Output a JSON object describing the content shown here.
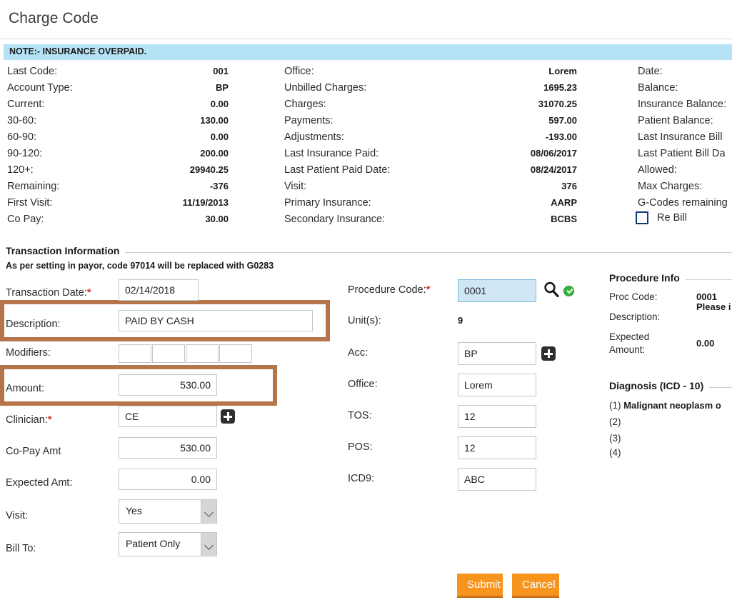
{
  "header": {
    "title": "Charge Code"
  },
  "note": {
    "text": "NOTE:- INSURANCE OVERPAID."
  },
  "summary": {
    "column1": [
      {
        "label": "Last Code:",
        "value": "001"
      },
      {
        "label": "Account Type:",
        "value": "BP"
      },
      {
        "label": "Current:",
        "value": "0.00"
      },
      {
        "label": "30-60:",
        "value": "130.00"
      },
      {
        "label": "60-90:",
        "value": "0.00"
      },
      {
        "label": "90-120:",
        "value": "200.00"
      },
      {
        "label": "120+:",
        "value": "29940.25"
      },
      {
        "label": "Remaining:",
        "value": "-376"
      },
      {
        "label": "First Visit:",
        "value": "11/19/2013"
      },
      {
        "label": "Co Pay:",
        "value": "30.00"
      }
    ],
    "column2": [
      {
        "label": "Office:",
        "value": "Lorem"
      },
      {
        "label": "Unbilled Charges:",
        "value": "1695.23"
      },
      {
        "label": "Charges:",
        "value": "31070.25"
      },
      {
        "label": "Payments:",
        "value": "597.00"
      },
      {
        "label": "Adjustments:",
        "value": "-193.00"
      },
      {
        "label": "Last Insurance Paid:",
        "value": "08/06/2017"
      },
      {
        "label": "Last Patient Paid Date:",
        "value": "08/24/2017"
      },
      {
        "label": "Visit:",
        "value": "376"
      },
      {
        "label": "Primary Insurance:",
        "value": "AARP"
      },
      {
        "label": "Secondary Insurance:",
        "value": "BCBS"
      }
    ],
    "column3": [
      {
        "label": "Date:"
      },
      {
        "label": "Balance:"
      },
      {
        "label": "Insurance Balance:"
      },
      {
        "label": "Patient Balance:"
      },
      {
        "label": "Last Insurance Bill"
      },
      {
        "label": "Last Patient Bill Da"
      },
      {
        "label": "Allowed:"
      },
      {
        "label": "Max Charges:"
      },
      {
        "label": "G-Codes remaining"
      }
    ],
    "rebill": {
      "label": "Re Bill",
      "checked": false
    }
  },
  "transaction": {
    "section_title": "Transaction Information",
    "note": "As per setting in payor, code 97014 will be replaced with G0283",
    "left_fields": {
      "transaction_date": {
        "label": "Transaction Date:",
        "required": "*",
        "value": "02/14/2018"
      },
      "description": {
        "label": "Description:",
        "value": "PAID BY CASH"
      },
      "modifiers": {
        "label": "Modifiers:",
        "values": [
          "",
          "",
          "",
          ""
        ]
      },
      "amount": {
        "label": "Amount:",
        "value": "530.00"
      },
      "clinician": {
        "label": "Clinician:",
        "required": "*",
        "value": "CE"
      },
      "copay_amt": {
        "label": "Co-Pay Amt",
        "value": "530.00"
      },
      "expected_amt": {
        "label": "Expected Amt:",
        "value": "0.00"
      },
      "visit": {
        "label": "Visit:",
        "value": "Yes"
      },
      "bill_to": {
        "label": "Bill To:",
        "value": "Patient Only"
      }
    },
    "middle_fields": {
      "procedure_code": {
        "label": "Procedure Code:",
        "required": "*",
        "value": "0001"
      },
      "units": {
        "label": "Unit(s):",
        "value": "9"
      },
      "acc": {
        "label": "Acc:",
        "value": "BP"
      },
      "office": {
        "label": "Office:",
        "value": "Lorem"
      },
      "tos": {
        "label": "TOS:",
        "value": "12"
      },
      "pos": {
        "label": "POS:",
        "value": "12"
      },
      "icd9": {
        "label": "ICD9:",
        "value": "ABC"
      }
    }
  },
  "procedure_info": {
    "title": "Procedure Info",
    "rows": [
      {
        "label": "Proc Code:",
        "value": "0001"
      },
      {
        "label": "Description:",
        "value": "Please i is for te"
      },
      {
        "label": "Expected Amount:",
        "value": "0.00"
      }
    ]
  },
  "diagnosis": {
    "title": "Diagnosis (ICD - 10)",
    "items": [
      {
        "index": "(1)",
        "text": "Malignant neoplasm o"
      },
      {
        "index": "(2)",
        "text": ""
      },
      {
        "index": "(3)",
        "text": ""
      },
      {
        "index": "(4)",
        "text": ""
      }
    ]
  },
  "actions": {
    "submit": "Submit",
    "cancel": "Cancel"
  },
  "colors": {
    "accent": "#f7941e",
    "note_bg": "#b5e3f5",
    "highlight": "#b5744a",
    "field_focus": "#cfe7f5"
  }
}
